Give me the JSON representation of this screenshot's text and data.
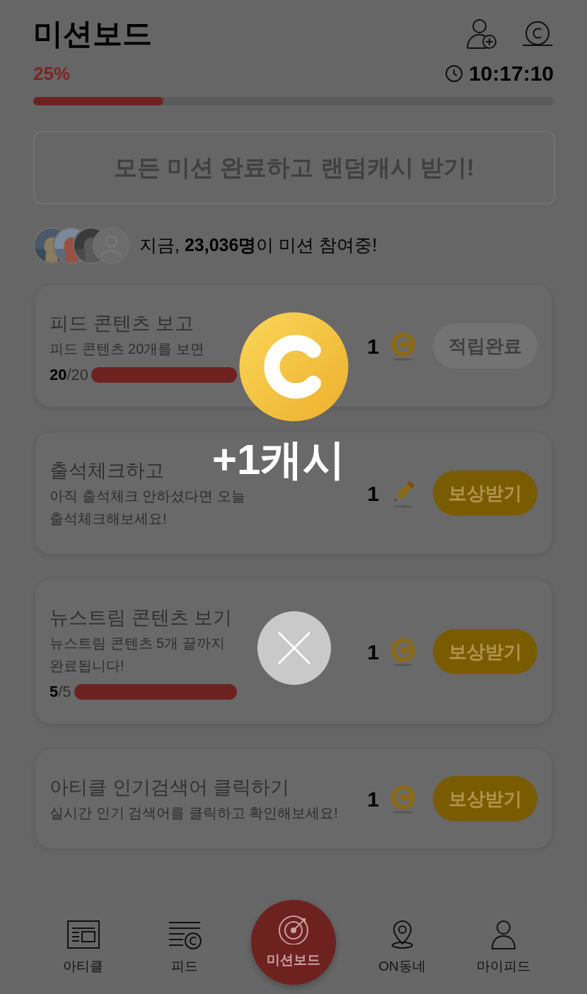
{
  "header": {
    "title": "미션보드"
  },
  "progress": {
    "percent": "25%",
    "timer": "10:17:10",
    "level": 0.25
  },
  "all_missions_button": {
    "label": "모든 미션 완료하고 랜덤캐시 받기!"
  },
  "participants": {
    "avatars": [
      {
        "kind": "picture"
      },
      {
        "kind": "picture"
      },
      {
        "kind": "picture"
      },
      {
        "kind": "placeholder"
      }
    ],
    "text": "지금, **23,036명**이 미션 참여중!"
  },
  "missions": [
    {
      "kind": "coin",
      "title": "피드 콘텐츠 보고",
      "description": "피드 콘텐츠 20개를 보면",
      "done": "20",
      "total": "/20",
      "level": 1,
      "reward": "1",
      "button": "적립완료",
      "claimed": true
    },
    {
      "kind": "pencil",
      "title": "출석체크하고",
      "description": "아직 출석체크 안하셨다면 오늘\n출석체크해보세요!",
      "reward": "1",
      "button": "보상받기",
      "claimed": false
    },
    {
      "kind": "coin",
      "title": "뉴스트림 콘텐츠 보기",
      "description": "뉴스트림 콘텐츠 5개 끝까지\n완료됩니다!",
      "done": "5",
      "total": "/5",
      "level": 1,
      "reward": "1",
      "button": "보상받기",
      "claimed": false
    },
    {
      "kind": "coin",
      "title": "아티클 인기검색어 클릭하기",
      "description": "실시간 인기 검색어를 클릭하고 확인해보세요!",
      "reward": "1",
      "button": "보상받기",
      "claimed": false
    }
  ],
  "reward_popup": {
    "amount": "+1캐시"
  },
  "nav": [
    {
      "label": "아티클",
      "selected": false
    },
    {
      "label": "피드",
      "selected": false
    },
    {
      "label": "미션보드",
      "selected": true
    },
    {
      "label": "ON동네",
      "selected": false
    },
    {
      "label": "마이피드",
      "selected": false
    }
  ]
}
